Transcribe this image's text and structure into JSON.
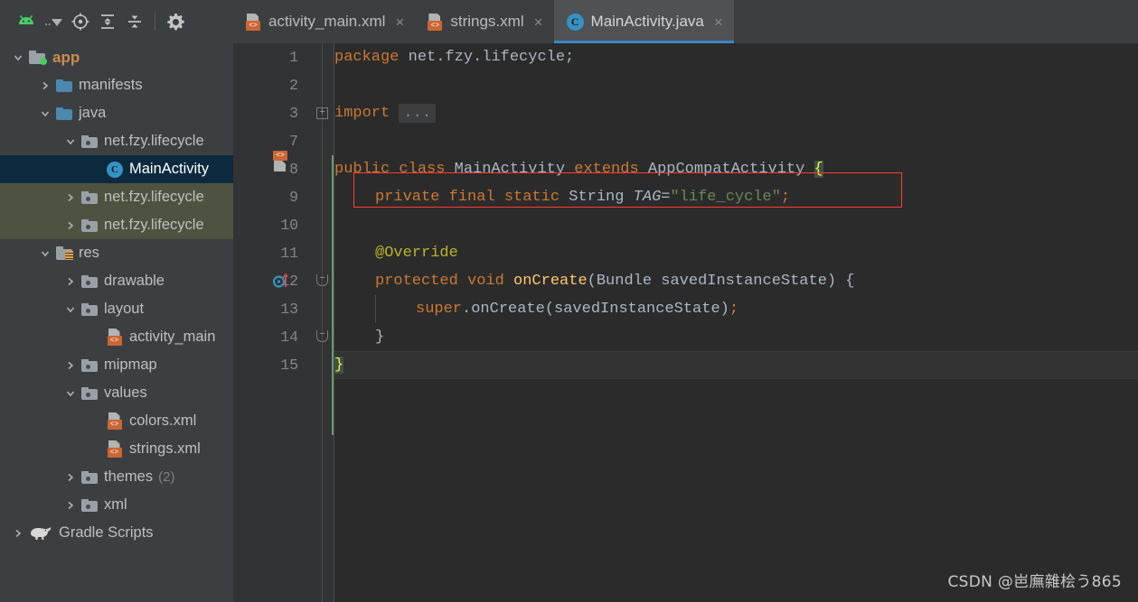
{
  "toolbar": {
    "items": [
      {
        "name": "android-logo-icon",
        "label": "Android"
      },
      {
        "name": "project-view-dropdown",
        "label": "Project view selector"
      },
      {
        "name": "locate-file-icon",
        "label": "Select Opened File"
      },
      {
        "name": "expand-all-icon",
        "label": "Expand All"
      },
      {
        "name": "collapse-all-icon",
        "label": "Collapse All"
      },
      {
        "name": "settings-gear-icon",
        "label": "Settings"
      }
    ]
  },
  "tabs": [
    {
      "label": "activity_main.xml",
      "icon": "xml-file-icon",
      "active": false,
      "close": "×"
    },
    {
      "label": "strings.xml",
      "icon": "xml-file-icon",
      "active": false,
      "close": "×"
    },
    {
      "label": "MainActivity.java",
      "icon": "java-class-icon",
      "active": true,
      "close": "×"
    }
  ],
  "sidebar": {
    "tree": [
      {
        "label": "app",
        "suffix": "",
        "indent": 0,
        "arrow": "down",
        "icon": "module-folder-icon",
        "style": "app",
        "state": "normal"
      },
      {
        "label": "manifests",
        "suffix": "",
        "indent": 1,
        "arrow": "right",
        "icon": "blue-folder-icon",
        "style": "blue",
        "state": "normal"
      },
      {
        "label": "java",
        "suffix": "",
        "indent": 1,
        "arrow": "down",
        "icon": "blue-folder-icon",
        "style": "blue",
        "state": "normal"
      },
      {
        "label": "net.fzy.lifecycle",
        "suffix": "",
        "indent": 2,
        "arrow": "down",
        "icon": "package-folder-icon",
        "style": "gray",
        "state": "normal"
      },
      {
        "label": "MainActivity",
        "suffix": "",
        "indent": 3,
        "arrow": "none",
        "icon": "java-class-icon",
        "style": "class",
        "state": "selected"
      },
      {
        "label": "net.fzy.lifecycle",
        "suffix": "",
        "indent": 2,
        "arrow": "right",
        "icon": "package-folder-icon",
        "style": "gray",
        "state": "test"
      },
      {
        "label": "net.fzy.lifecycle",
        "suffix": "",
        "indent": 2,
        "arrow": "right",
        "icon": "package-folder-icon",
        "style": "gray",
        "state": "test"
      },
      {
        "label": "res",
        "suffix": "",
        "indent": 1,
        "arrow": "down",
        "icon": "res-folder-icon",
        "style": "res",
        "state": "normal"
      },
      {
        "label": "drawable",
        "suffix": "",
        "indent": 2,
        "arrow": "right",
        "icon": "package-folder-icon",
        "style": "gray",
        "state": "normal"
      },
      {
        "label": "layout",
        "suffix": "",
        "indent": 2,
        "arrow": "down",
        "icon": "package-folder-icon",
        "style": "gray",
        "state": "normal"
      },
      {
        "label": "activity_main",
        "suffix": "",
        "indent": 3,
        "arrow": "none",
        "icon": "xml-file-icon",
        "style": "xml",
        "state": "normal"
      },
      {
        "label": "mipmap",
        "suffix": "",
        "indent": 2,
        "arrow": "right",
        "icon": "package-folder-icon",
        "style": "gray",
        "state": "normal"
      },
      {
        "label": "values",
        "suffix": "",
        "indent": 2,
        "arrow": "down",
        "icon": "package-folder-icon",
        "style": "gray",
        "state": "normal"
      },
      {
        "label": "colors.xml",
        "suffix": "",
        "indent": 3,
        "arrow": "none",
        "icon": "xml-file-icon",
        "style": "xml",
        "state": "normal"
      },
      {
        "label": "strings.xml",
        "suffix": "",
        "indent": 3,
        "arrow": "none",
        "icon": "xml-file-icon",
        "style": "xml",
        "state": "normal"
      },
      {
        "label": "themes",
        "suffix": "(2)",
        "indent": 2,
        "arrow": "right",
        "icon": "package-folder-icon",
        "style": "gray",
        "state": "normal"
      },
      {
        "label": "xml",
        "suffix": "",
        "indent": 2,
        "arrow": "right",
        "icon": "package-folder-icon",
        "style": "gray",
        "state": "normal"
      },
      {
        "label": "Gradle Scripts",
        "suffix": "",
        "indent": 0,
        "arrow": "right",
        "icon": "gradle-elephant-icon",
        "style": "gradle",
        "state": "normal"
      }
    ]
  },
  "editor": {
    "file": "MainActivity.java",
    "line_numbers": [
      "1",
      "2",
      "3",
      "7",
      "8",
      "9",
      "10",
      "11",
      "12",
      "13",
      "14",
      "15"
    ],
    "caret_line": "15",
    "lines": [
      {
        "num": "1",
        "text": "package net.fzy.lifecycle;"
      },
      {
        "num": "2",
        "text": ""
      },
      {
        "num": "3",
        "text": "import ..."
      },
      {
        "num": "7",
        "text": ""
      },
      {
        "num": "8",
        "text": "public class MainActivity extends AppCompatActivity {"
      },
      {
        "num": "9",
        "text": "    private final static String TAG=\"life_cycle\";"
      },
      {
        "num": "10",
        "text": ""
      },
      {
        "num": "11",
        "text": "    @Override"
      },
      {
        "num": "12",
        "text": "    protected void onCreate(Bundle savedInstanceState) {"
      },
      {
        "num": "13",
        "text": "        super.onCreate(savedInstanceState);"
      },
      {
        "num": "14",
        "text": "    }"
      },
      {
        "num": "15",
        "text": "}"
      }
    ],
    "tokens": {
      "l1_kw": "package",
      "l1_pkg": " net.fzy.lifecycle;",
      "l3_kw": "import",
      "l3_ellipsis": "...",
      "l8_a": "public class ",
      "l8_b": "MainActivity",
      "l8_c": " extends ",
      "l8_d": "AppCompatActivity ",
      "l8_brace": "{",
      "l9_a": "private final static ",
      "l9_b": "String ",
      "l9_c": "TAG",
      "l9_d": "=",
      "l9_e": "\"life_cycle\"",
      "l9_f": ";",
      "l11_annotation": "@Override",
      "l12_a": "protected void ",
      "l12_b": "onCreate",
      "l12_c": "(Bundle savedInstanceState) {",
      "l13_a": "super",
      "l13_b": ".onCreate(savedInstanceState)",
      "l13_c": ";",
      "l14": "}",
      "l15_brace": "}"
    },
    "gutter_markers": [
      {
        "line": "8",
        "name": "related-layout-icon"
      },
      {
        "line": "12",
        "name": "override-method-icon"
      }
    ],
    "fold_markers": [
      {
        "line": "3",
        "glyph": "+",
        "name": "fold-expand-icon"
      },
      {
        "line": "12",
        "glyph": "−",
        "name": "fold-collapse-icon"
      },
      {
        "line": "14",
        "glyph": "−",
        "name": "fold-collapse-end-icon"
      }
    ],
    "annotation_box": {
      "name": "red-highlight-box",
      "target_line": "9"
    }
  },
  "watermark": "CSDN @岜廡雜桧う865",
  "colors": {
    "accent_blue": "#3d86c9",
    "selection_navy": "#0d293e",
    "test_source_olive": "#4d5340",
    "keyword_orange": "#cc7832",
    "string_green": "#6a8759",
    "annotation_yellow": "#bbb529",
    "method_gold": "#ffc66d",
    "plain_text": "#a9b7c6",
    "error_red": "#ff3b30",
    "android_green": "#45d063",
    "xml_orange": "#cc6633",
    "panel_bg": "#3c3f41",
    "editor_bg": "#2b2b2b",
    "gutter_bg": "#313335"
  }
}
